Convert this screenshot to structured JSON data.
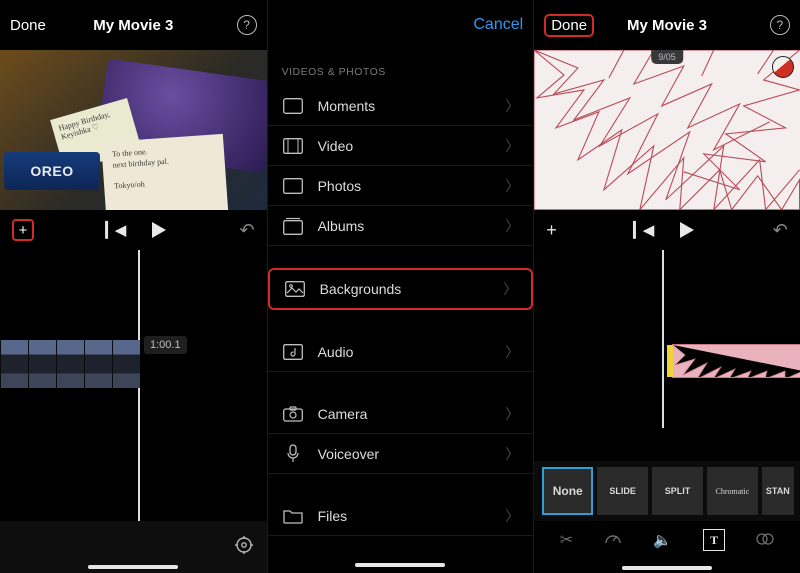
{
  "panel1": {
    "done": "Done",
    "title": "My Movie 3",
    "preview": {
      "oreo": "OREO",
      "note_line1": "To the one.",
      "note_line2": "next birthday pal.",
      "note_line3": "Tokyo/oh",
      "note2": "Happy Birthday, Keyishka ♡"
    },
    "timecode": "1:00.1"
  },
  "panel2": {
    "cancel": "Cancel",
    "section": "VIDEOS & PHOTOS",
    "rows": [
      {
        "icon": "moments",
        "label": "Moments"
      },
      {
        "icon": "video",
        "label": "Video"
      },
      {
        "icon": "photos",
        "label": "Photos"
      },
      {
        "icon": "albums",
        "label": "Albums"
      },
      {
        "icon": "backgrounds",
        "label": "Backgrounds",
        "highlighted": true
      },
      {
        "icon": "audio",
        "label": "Audio"
      },
      {
        "icon": "camera",
        "label": "Camera"
      },
      {
        "icon": "voiceover",
        "label": "Voiceover"
      },
      {
        "icon": "files",
        "label": "Files"
      }
    ]
  },
  "panel3": {
    "done": "Done",
    "title": "My Movie 3",
    "badge_time": "9/05",
    "filters": [
      "None",
      "SLIDE",
      "SPLIT",
      "Chromatic",
      "STAN"
    ],
    "tool_text": "T"
  }
}
